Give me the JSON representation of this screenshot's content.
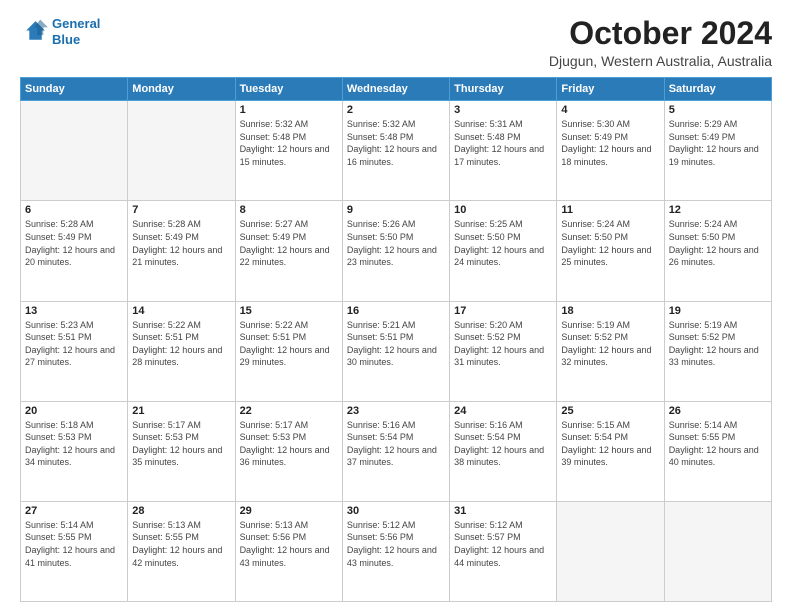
{
  "logo": {
    "line1": "General",
    "line2": "Blue"
  },
  "title": "October 2024",
  "location": "Djugun, Western Australia, Australia",
  "days_of_week": [
    "Sunday",
    "Monday",
    "Tuesday",
    "Wednesday",
    "Thursday",
    "Friday",
    "Saturday"
  ],
  "weeks": [
    [
      {
        "day": "",
        "info": ""
      },
      {
        "day": "",
        "info": ""
      },
      {
        "day": "1",
        "info": "Sunrise: 5:32 AM\nSunset: 5:48 PM\nDaylight: 12 hours and 15 minutes."
      },
      {
        "day": "2",
        "info": "Sunrise: 5:32 AM\nSunset: 5:48 PM\nDaylight: 12 hours and 16 minutes."
      },
      {
        "day": "3",
        "info": "Sunrise: 5:31 AM\nSunset: 5:48 PM\nDaylight: 12 hours and 17 minutes."
      },
      {
        "day": "4",
        "info": "Sunrise: 5:30 AM\nSunset: 5:49 PM\nDaylight: 12 hours and 18 minutes."
      },
      {
        "day": "5",
        "info": "Sunrise: 5:29 AM\nSunset: 5:49 PM\nDaylight: 12 hours and 19 minutes."
      }
    ],
    [
      {
        "day": "6",
        "info": "Sunrise: 5:28 AM\nSunset: 5:49 PM\nDaylight: 12 hours and 20 minutes."
      },
      {
        "day": "7",
        "info": "Sunrise: 5:28 AM\nSunset: 5:49 PM\nDaylight: 12 hours and 21 minutes."
      },
      {
        "day": "8",
        "info": "Sunrise: 5:27 AM\nSunset: 5:49 PM\nDaylight: 12 hours and 22 minutes."
      },
      {
        "day": "9",
        "info": "Sunrise: 5:26 AM\nSunset: 5:50 PM\nDaylight: 12 hours and 23 minutes."
      },
      {
        "day": "10",
        "info": "Sunrise: 5:25 AM\nSunset: 5:50 PM\nDaylight: 12 hours and 24 minutes."
      },
      {
        "day": "11",
        "info": "Sunrise: 5:24 AM\nSunset: 5:50 PM\nDaylight: 12 hours and 25 minutes."
      },
      {
        "day": "12",
        "info": "Sunrise: 5:24 AM\nSunset: 5:50 PM\nDaylight: 12 hours and 26 minutes."
      }
    ],
    [
      {
        "day": "13",
        "info": "Sunrise: 5:23 AM\nSunset: 5:51 PM\nDaylight: 12 hours and 27 minutes."
      },
      {
        "day": "14",
        "info": "Sunrise: 5:22 AM\nSunset: 5:51 PM\nDaylight: 12 hours and 28 minutes."
      },
      {
        "day": "15",
        "info": "Sunrise: 5:22 AM\nSunset: 5:51 PM\nDaylight: 12 hours and 29 minutes."
      },
      {
        "day": "16",
        "info": "Sunrise: 5:21 AM\nSunset: 5:51 PM\nDaylight: 12 hours and 30 minutes."
      },
      {
        "day": "17",
        "info": "Sunrise: 5:20 AM\nSunset: 5:52 PM\nDaylight: 12 hours and 31 minutes."
      },
      {
        "day": "18",
        "info": "Sunrise: 5:19 AM\nSunset: 5:52 PM\nDaylight: 12 hours and 32 minutes."
      },
      {
        "day": "19",
        "info": "Sunrise: 5:19 AM\nSunset: 5:52 PM\nDaylight: 12 hours and 33 minutes."
      }
    ],
    [
      {
        "day": "20",
        "info": "Sunrise: 5:18 AM\nSunset: 5:53 PM\nDaylight: 12 hours and 34 minutes."
      },
      {
        "day": "21",
        "info": "Sunrise: 5:17 AM\nSunset: 5:53 PM\nDaylight: 12 hours and 35 minutes."
      },
      {
        "day": "22",
        "info": "Sunrise: 5:17 AM\nSunset: 5:53 PM\nDaylight: 12 hours and 36 minutes."
      },
      {
        "day": "23",
        "info": "Sunrise: 5:16 AM\nSunset: 5:54 PM\nDaylight: 12 hours and 37 minutes."
      },
      {
        "day": "24",
        "info": "Sunrise: 5:16 AM\nSunset: 5:54 PM\nDaylight: 12 hours and 38 minutes."
      },
      {
        "day": "25",
        "info": "Sunrise: 5:15 AM\nSunset: 5:54 PM\nDaylight: 12 hours and 39 minutes."
      },
      {
        "day": "26",
        "info": "Sunrise: 5:14 AM\nSunset: 5:55 PM\nDaylight: 12 hours and 40 minutes."
      }
    ],
    [
      {
        "day": "27",
        "info": "Sunrise: 5:14 AM\nSunset: 5:55 PM\nDaylight: 12 hours and 41 minutes."
      },
      {
        "day": "28",
        "info": "Sunrise: 5:13 AM\nSunset: 5:55 PM\nDaylight: 12 hours and 42 minutes."
      },
      {
        "day": "29",
        "info": "Sunrise: 5:13 AM\nSunset: 5:56 PM\nDaylight: 12 hours and 43 minutes."
      },
      {
        "day": "30",
        "info": "Sunrise: 5:12 AM\nSunset: 5:56 PM\nDaylight: 12 hours and 43 minutes."
      },
      {
        "day": "31",
        "info": "Sunrise: 5:12 AM\nSunset: 5:57 PM\nDaylight: 12 hours and 44 minutes."
      },
      {
        "day": "",
        "info": ""
      },
      {
        "day": "",
        "info": ""
      }
    ]
  ]
}
